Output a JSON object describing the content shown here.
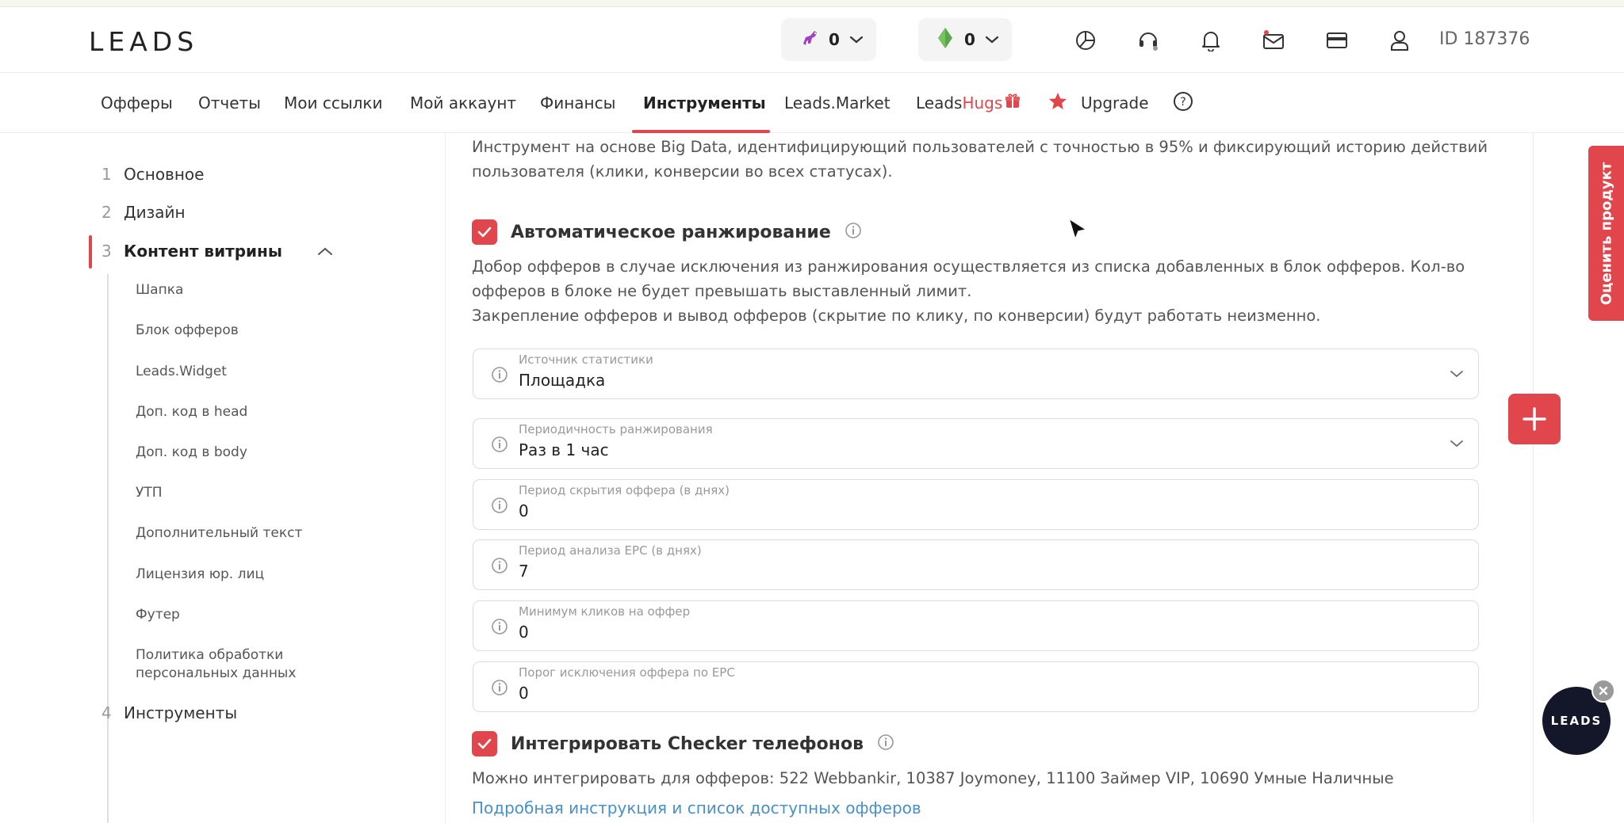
{
  "header": {
    "logo": "LEADS",
    "counter1": {
      "value": "0",
      "icon": "dino-icon"
    },
    "counter2": {
      "value": "0",
      "icon": "gem-icon"
    },
    "user_id": "ID 187376",
    "icons": [
      "stats-icon",
      "support-icon",
      "bell-icon",
      "mail-icon",
      "card-icon",
      "user-icon"
    ]
  },
  "nav": {
    "items": [
      {
        "label": "Офферы"
      },
      {
        "label": "Отчеты"
      },
      {
        "label": "Мои ссылки"
      },
      {
        "label": "Мой аккаунт"
      },
      {
        "label": "Финансы"
      },
      {
        "label": "Инструменты",
        "active": true
      },
      {
        "label": "Leads.Market"
      }
    ],
    "hugs_prefix": "Leads",
    "hugs_suffix": "Hugs",
    "upgrade": "Upgrade",
    "help": "?"
  },
  "sidebar": {
    "steps": [
      {
        "num": "1",
        "label": "Основное"
      },
      {
        "num": "2",
        "label": "Дизайн"
      },
      {
        "num": "3",
        "label": "Контент витрины",
        "active": true
      },
      {
        "num": "4",
        "label": "Инструменты"
      }
    ],
    "subitems": [
      "Шапка",
      "Блок офферов",
      "Leads.Widget",
      "Доп. код в head",
      "Доп. код в body",
      "УТП",
      "Дополнительный текст",
      "Лицензия юр. лиц",
      "Футер",
      "Политика обработки персональных данных"
    ]
  },
  "main": {
    "intro": "Инструмент на основе Big Data, идентифицирующий пользователей с точностью в 95% и фиксирующий историю действий пользователя (клики, конверсии во всех статусах).",
    "auto_ranking": {
      "checked": true,
      "title": "Автоматическое ранжирование",
      "desc1": "Добор офферов в случае исключения из ранжирования осуществляется из списка добавленных в блок офферов. Кол-во офферов в блоке не будет превышать выставленный лимит.",
      "desc2": "Закрепление офферов и вывод офферов (скрытие по клику, по конверсии) будут работать неизменно."
    },
    "fields": [
      {
        "label": "Источник статистики",
        "value": "Площадка",
        "dropdown": true
      },
      {
        "label": "Периодичность ранжирования",
        "value": "Раз в 1 час",
        "dropdown": true
      },
      {
        "label": "Период скрытия оффера (в днях)",
        "value": "0"
      },
      {
        "label": "Период анализа EPC (в днях)",
        "value": "7"
      },
      {
        "label": "Минимум кликов на оффер",
        "value": "0"
      },
      {
        "label": "Порог исключения оффера по EPC",
        "value": "0"
      }
    ],
    "checker": {
      "checked": true,
      "title": "Интегрировать Checker телефонов",
      "desc": "Можно интегрировать для офферов: 522 Webbankir, 10387 Joymoney, 11100 Займер VIP, 10690 Умные Наличные",
      "link": "Подробная инструкция и список доступных офферов"
    }
  },
  "floating": {
    "rate_label": "Оценить продукт",
    "bubble_label": "LEADS"
  },
  "colors": {
    "accent": "#e0464b",
    "link": "#4a90c8",
    "dark": "#14172a"
  }
}
